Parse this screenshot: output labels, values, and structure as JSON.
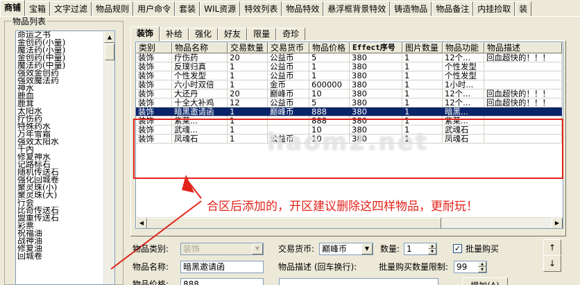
{
  "top_tabs": [
    "商铺",
    "宝箱",
    "文字过滤",
    "物品规则",
    "用户命令",
    "套装",
    "WIL资源",
    "特效列表",
    "物品特效",
    "悬浮框背景特效",
    "铸造物品",
    "物品备注",
    "内挂捡取",
    "装"
  ],
  "item_list": {
    "title": "物品列表",
    "items": [
      "命运之书",
      "金创药(小量)",
      "魔法药(小量)",
      "金创药(中量)",
      "魔法药(中量)",
      "强效金创药",
      "强效魔法药",
      "神水",
      "鹿血",
      "鹿茸",
      "太阳水",
      "疗伤药",
      "特殊药水",
      "万年雪霜",
      "强效太阳水",
      "千內",
      "修复神水",
      "记路标石",
      "随机传送石",
      "强化回城卷",
      "聚灵珠(小)",
      "聚灵珠(大)",
      "行会",
      "比奇传送石",
      "盟重传送石",
      "彩票",
      "祝福油",
      "战神油",
      "修复油",
      "回城卷"
    ]
  },
  "inner_tabs": [
    "装饰",
    "补给",
    "强化",
    "好友",
    "限量",
    "奇珍"
  ],
  "grid": {
    "columns": [
      "类别",
      "物品名称",
      "交易数量",
      "交易货币",
      "物品价格",
      "Effect序号",
      "图片数量",
      "物品功能",
      "物品描述"
    ],
    "rows": [
      [
        "装饰",
        "疗伤药",
        "20",
        "公益币",
        "5",
        "380",
        "1",
        "12个...",
        "回血超快的！！！"
      ],
      [
        "装饰",
        "反璞归真",
        "1",
        "公益币",
        "1",
        "380",
        "1",
        "个性发型",
        ""
      ],
      [
        "装饰",
        "个性发型",
        "1",
        "公益币",
        "1",
        "380",
        "1",
        "个性发型",
        ""
      ],
      [
        "装饰",
        "六小时双倍",
        "1",
        "金币",
        "600000",
        "380",
        "1",
        "1小时...",
        ""
      ],
      [
        "装饰",
        "大还丹",
        "20",
        "巅峰币",
        "10",
        "380",
        "1",
        "12个...",
        "回血超快的！！！"
      ],
      [
        "装饰",
        "十全大补鸡",
        "12",
        "公益币",
        "5",
        "380",
        "1",
        "12个...",
        "回血超快的！！！"
      ],
      [
        "装饰",
        "暗黑邀请函",
        "1",
        "巅峰币",
        "888",
        "380",
        "1",
        "暗黑...",
        ""
      ],
      [
        "装饰",
        "紫莱...",
        "1",
        "",
        "888",
        "380",
        "1",
        "紫莱...",
        ""
      ],
      [
        "装饰",
        "武魂...",
        "1",
        "",
        "10",
        "380",
        "1",
        "武魂石",
        ""
      ],
      [
        "装饰",
        "凤魂石",
        "1",
        "公益币",
        "10",
        "380",
        "1",
        "凤魂石",
        ""
      ]
    ],
    "selected_row": 6
  },
  "annotation": {
    "text": "合区后添加的，开区建议删除这四样物品，更耐玩！",
    "color": "#e2231a"
  },
  "watermark": "haom2.net",
  "form": {
    "category_label": "物品类别:",
    "category_value": "装饰",
    "currency_label": "交易货币:",
    "currency_value": "巅峰币",
    "quantity_label": "数量:",
    "quantity_value": "1",
    "bulk_buy_label": "批量购买",
    "bulk_buy_checked": true,
    "name_label": "物品名称:",
    "name_value": "暗黑邀请函",
    "desc_label": "物品描述 (回车换行):",
    "bulk_limit_label": "批量购买数量限制:",
    "bulk_limit_value": "99",
    "price_label": "物品价格:",
    "price_value": "888",
    "add_button": "增加(A)",
    "up_button": "↑",
    "down_button": "↓"
  },
  "colors": {
    "selection": "#0a246a",
    "window_bg": "#ece9d8"
  }
}
